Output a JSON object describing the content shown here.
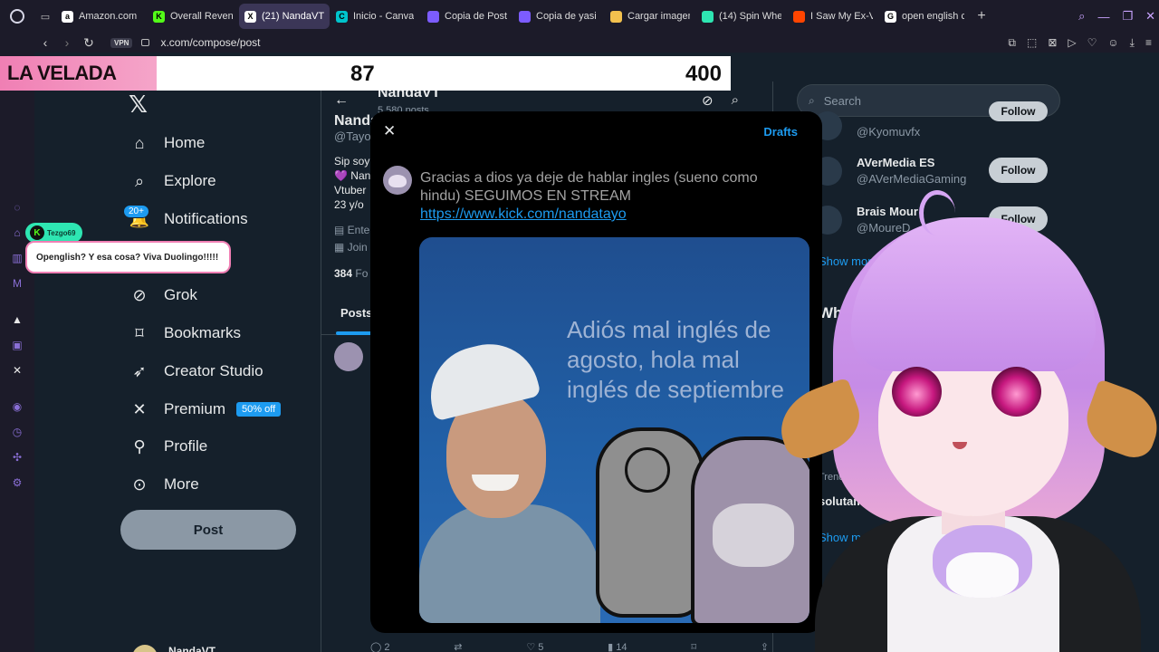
{
  "browser": {
    "tabs": [
      {
        "label": "Amazon.com",
        "color": "#ffffff",
        "glyph": "a",
        "active": false
      },
      {
        "label": "Overall Reven",
        "color": "#53fc18",
        "glyph": "K",
        "active": false
      },
      {
        "label": "(21) NandaVT (@TayoNa",
        "color": "#ffffff",
        "glyph": "X",
        "active": true
      },
      {
        "label": "Inicio - Canva",
        "color": "#00c4cc",
        "glyph": "C",
        "active": false
      },
      {
        "label": "Copia de Post",
        "color": "#7c5cff",
        "glyph": "",
        "active": false
      },
      {
        "label": "Copia de yasi",
        "color": "#7c5cff",
        "glyph": "",
        "active": false
      },
      {
        "label": "Cargar imagen",
        "color": "#f2c14e",
        "glyph": "",
        "active": false
      },
      {
        "label": "(14) Spin Whe",
        "color": "#2ee6b2",
        "glyph": "",
        "active": false
      },
      {
        "label": "I Saw My Ex-V",
        "color": "#ff4500",
        "glyph": "",
        "active": false
      },
      {
        "label": "open english c",
        "color": "#ffffff",
        "glyph": "G",
        "active": false
      }
    ],
    "vpn_label": "VPN",
    "url": "x.com/compose/post"
  },
  "overlay": {
    "goal_label": "LA VELADA",
    "goal_current": "87",
    "goal_target": "400",
    "chat_username": "Tezgo69",
    "chat_message": "Openglish? Y esa cosa? Viva Duolingo!!!!!"
  },
  "nav": {
    "home": "Home",
    "explore": "Explore",
    "notifications": "Notifications",
    "notifications_badge": "20+",
    "grok": "Grok",
    "bookmarks": "Bookmarks",
    "creator_studio": "Creator Studio",
    "premium": "Premium",
    "premium_badge": "50% off",
    "profile": "Profile",
    "more": "More",
    "post_button": "Post",
    "account_name": "NandaVT"
  },
  "profile": {
    "header_name": "NandaVT",
    "header_posts": "5,580 posts",
    "display_name": "Nanda",
    "handle": "@Tayo",
    "bio_lines": [
      "Sip soy",
      "💜 Nan",
      "Vtuber",
      "23 y/o"
    ],
    "meta_1": "Ente",
    "meta_2": "Join",
    "following_count": "384",
    "following_label": "Fo",
    "tab_posts": "Posts",
    "action_replies": "2",
    "action_likes": "5",
    "action_views": "14"
  },
  "right": {
    "search_placeholder": "Search",
    "suggestions": [
      {
        "name": "",
        "handle": "@Kyomuvfx",
        "button": "Follow"
      },
      {
        "name": "AVerMedia ES",
        "handle": "@AVerMediaGaming",
        "button": "Follow"
      },
      {
        "name": "Brais Mour",
        "handle": "@MoureD",
        "button": "Follow"
      }
    ],
    "show_more": "Show more",
    "whats_happening": "Wha",
    "trend_meta": "Trending in Venez",
    "trend_title": "solutamente",
    "show_more_2": "Show more"
  },
  "compose": {
    "drafts": "Drafts",
    "text": "Gracias a dios ya deje de hablar ingles (sueno como hindu) SEGUIMOS EN STREAM",
    "link": "https://www.kick.com/nandatayo",
    "image_caption": "Adiós mal inglés de agosto, hola mal inglés de septiembre"
  }
}
